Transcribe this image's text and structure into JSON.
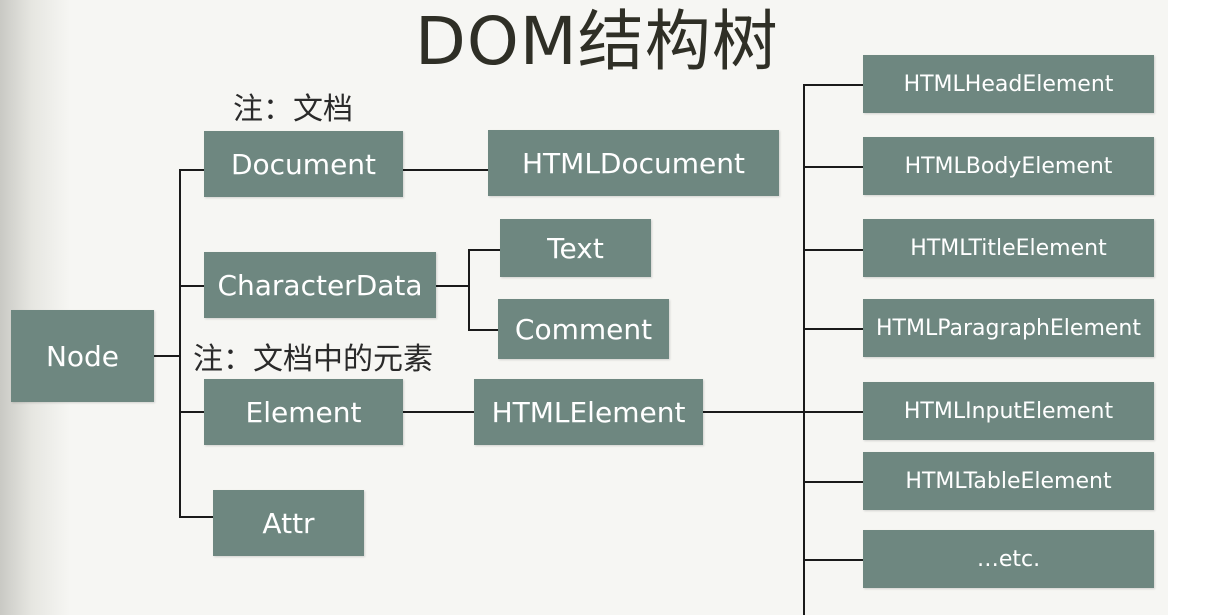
{
  "title": "DOM结构树",
  "notes": {
    "document_note": "注：文档",
    "element_note": "注：文档中的元素"
  },
  "nodes": {
    "node": "Node",
    "document": "Document",
    "html_document": "HTMLDocument",
    "character_data": "CharacterData",
    "text": "Text",
    "comment": "Comment",
    "element": "Element",
    "html_element": "HTMLElement",
    "attr": "Attr"
  },
  "html_element_children": [
    "HTMLHeadElement",
    "HTMLBodyElement",
    "HTMLTitleElement",
    "HTMLParagraphElement",
    "HTMLInputElement",
    "HTMLTableElement",
    "…etc."
  ],
  "colors": {
    "box": "#6e8780",
    "box_text": "#ffffff",
    "line": "#1a1a1a",
    "background": "#f6f6f3"
  }
}
